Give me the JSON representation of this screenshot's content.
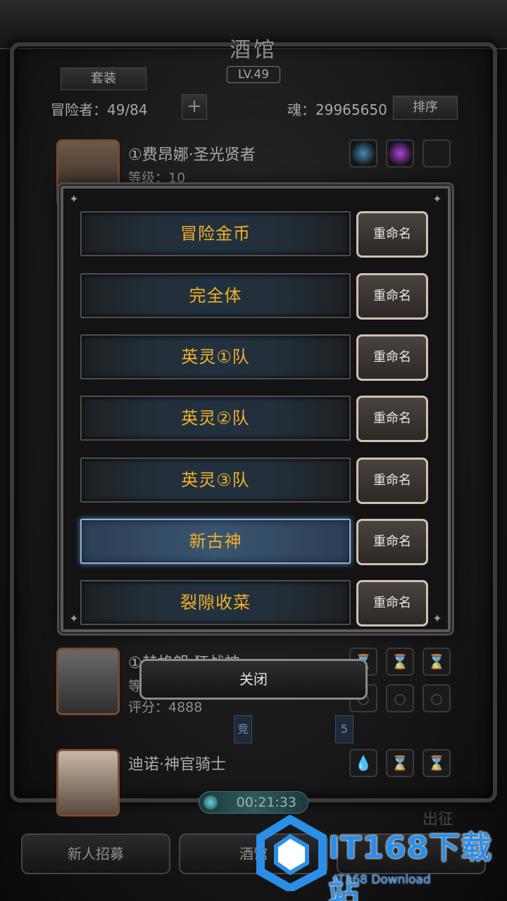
{
  "header": {
    "title": "酒馆",
    "level": "LV.49",
    "suit_button": "套装",
    "adventurers": "冒险者：49/84",
    "plus": "+",
    "soul": "魂：29965650",
    "sort_button": "排序"
  },
  "heroes": [
    {
      "name": "①费昂娜·圣光贤者",
      "level": "等级：10",
      "score": ""
    },
    {
      "name": "①赫格朗·狂战神",
      "level": "等",
      "score": "评分：4888"
    },
    {
      "name": "迪诺·神官骑士",
      "level": "",
      "score": ""
    }
  ],
  "tags": [
    "竞",
    "5"
  ],
  "dialog": {
    "rename_label": "重命名",
    "teams": [
      {
        "name": "冒险金币",
        "selected": false
      },
      {
        "name": "完全体",
        "selected": false
      },
      {
        "name": "英灵①队",
        "selected": false
      },
      {
        "name": "英灵②队",
        "selected": false
      },
      {
        "name": "英灵③队",
        "selected": false
      },
      {
        "name": "新古神",
        "selected": true
      },
      {
        "name": "裂隙收菜",
        "selected": false
      }
    ],
    "close_label": "关闭"
  },
  "footer": {
    "timer": "00:21:33",
    "recruit": "新人招募",
    "tavern": "酒馆",
    "depart": "出征"
  },
  "watermark": {
    "text": "IT168下载站",
    "sub": "IT168 Download"
  },
  "colors": {
    "team_text": "#f2b02a",
    "selected_border": "#8fb3d8",
    "watermark": "#2b8fe8"
  }
}
